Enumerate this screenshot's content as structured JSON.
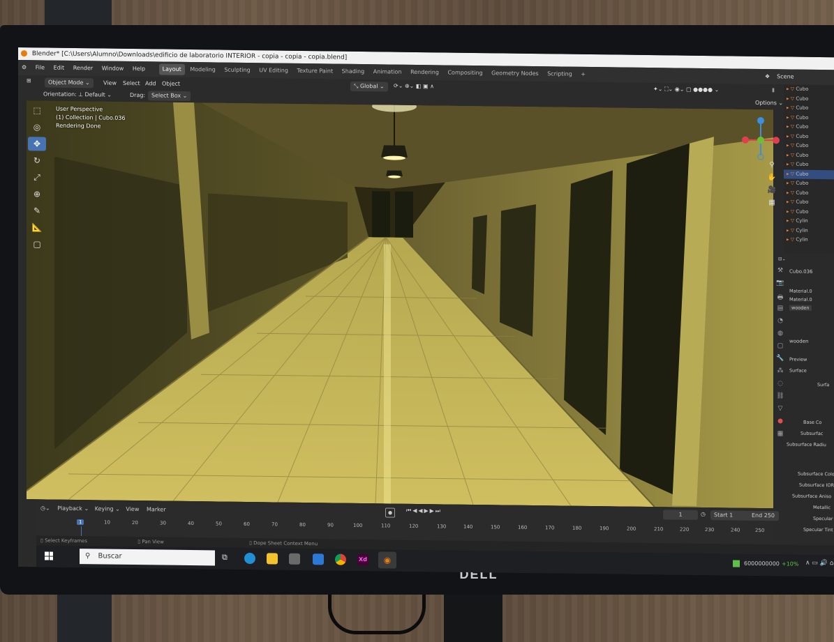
{
  "window": {
    "title": "Blender* [C:\\Users\\Alumno\\Downloads\\edificio de laboratorio INTERIOR - copia - copia - copia.blend]"
  },
  "menubar": {
    "items": [
      "File",
      "Edit",
      "Render",
      "Window",
      "Help"
    ],
    "workspaces": [
      "Layout",
      "Modeling",
      "Sculpting",
      "UV Editing",
      "Texture Paint",
      "Shading",
      "Animation",
      "Rendering",
      "Compositing",
      "Geometry Nodes",
      "Scripting"
    ],
    "active_workspace": "Layout",
    "add_tab": "+",
    "scene_label": "Scene"
  },
  "header": {
    "mode": "Object Mode",
    "menus": [
      "View",
      "Select",
      "Add",
      "Object"
    ],
    "transform_orientation": "Global",
    "orientation_label": "Orientation:",
    "orientation_value": "Default",
    "drag_label": "Drag:",
    "drag_value": "Select Box",
    "options_label": "Options"
  },
  "viewport": {
    "overlay_lines": [
      "User Perspective",
      "(1) Collection | Cubo.036",
      "Rendering Done"
    ]
  },
  "outliner": {
    "items": [
      "Cubo",
      "Cubo",
      "Cubo",
      "Cubo",
      "Cubo",
      "Cubo",
      "Cubo",
      "Cubo",
      "Cubo",
      "Cubo",
      "Cubo",
      "Cubo",
      "Cubo",
      "Cubo",
      "Cylin",
      "Cylin",
      "Cylin"
    ],
    "selected_index": 9
  },
  "properties": {
    "object_name": "Cubo.036",
    "material_slots": [
      "Material.0",
      "Material.0",
      "wooden"
    ],
    "material_name": "wooden",
    "sections": [
      "Preview",
      "Surface"
    ],
    "rows": [
      "Surfa",
      "Base Co",
      "Subsurfac",
      "Subsurface Radiu",
      "Subsurface Colo",
      "Subsurface IOR",
      "Subsurface Aniso",
      "Metallic",
      "Specular",
      "Specular Tint"
    ]
  },
  "timeline": {
    "menus": [
      "Playback",
      "Keying",
      "View",
      "Marker"
    ],
    "current_frame": "1",
    "start_label": "Start",
    "start_value": "1",
    "end_label": "End",
    "end_value": "250",
    "frame_ticks": [
      "1",
      "10",
      "20",
      "30",
      "40",
      "50",
      "60",
      "70",
      "80",
      "90",
      "100",
      "110",
      "120",
      "130",
      "140",
      "150",
      "160",
      "170",
      "180",
      "190",
      "200",
      "210",
      "220",
      "230",
      "240",
      "250"
    ]
  },
  "statusbar": {
    "left": "Select Keyframes",
    "middle": "Pan View",
    "right": "Dope Sheet Context Menu"
  },
  "taskbar": {
    "search_placeholder": "Buscar",
    "tray_text": "6000000000",
    "tray_percent": "+10%"
  },
  "monitor": {
    "brand": "DELL"
  }
}
